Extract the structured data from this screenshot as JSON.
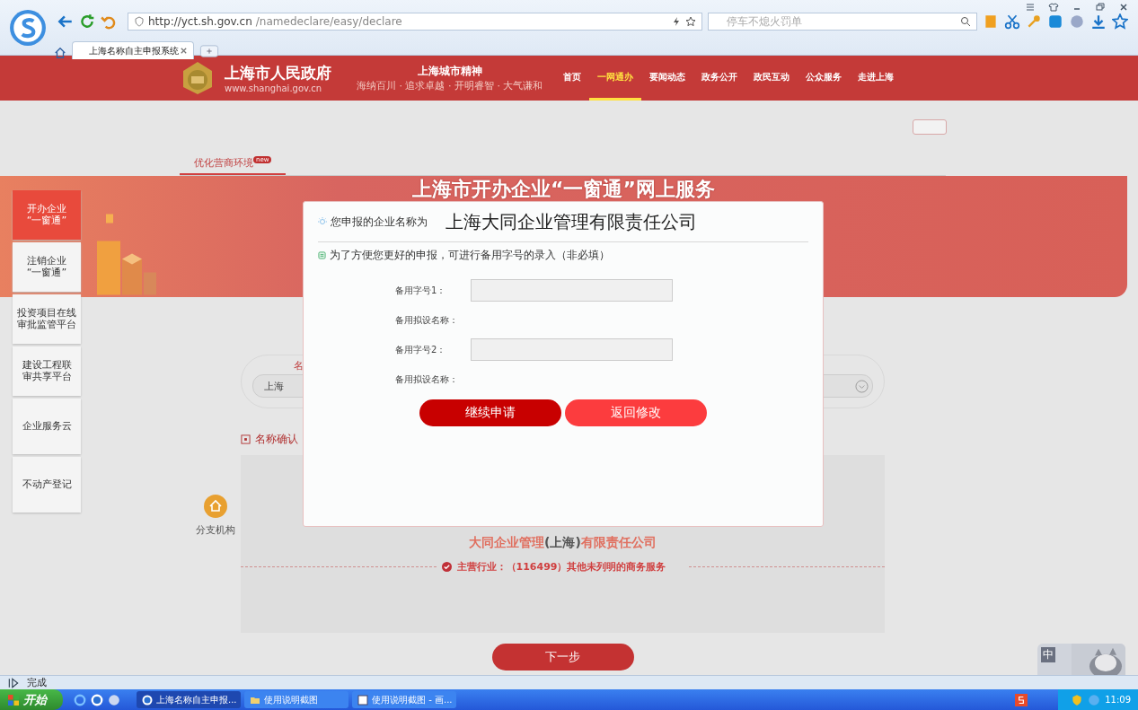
{
  "browser": {
    "address_host": "http://yct.sh.gov.cn",
    "address_path": "/namedeclare/easy/declare",
    "search_placeholder": "停车不熄火罚单",
    "tab_title": "上海名称自主申报系统"
  },
  "header": {
    "site_name": "上海市人民政府",
    "site_url": "www.shanghai.gov.cn",
    "slogan_title": "上海城市精神",
    "slogan": "海纳百川 · 追求卓越 · 开明睿智 · 大气谦和",
    "nav": [
      {
        "label": "首页",
        "selected": false
      },
      {
        "label": "一网通办",
        "selected": true
      },
      {
        "label": "要闻动态",
        "selected": false
      },
      {
        "label": "政务公开",
        "selected": false
      },
      {
        "label": "政民互动",
        "selected": false
      },
      {
        "label": "公众服务",
        "selected": false
      },
      {
        "label": "走进上海",
        "selected": false
      }
    ]
  },
  "subnav": {
    "label": "优化营商环境",
    "badge": "new"
  },
  "banner_title": "上海市开办企业“一窗通”网上服务",
  "sidebar": [
    {
      "lines": [
        "开办企业",
        "“一窗通”"
      ],
      "selected": true
    },
    {
      "lines": [
        "注销企业",
        "“一窗通”"
      ],
      "selected": false
    },
    {
      "lines": [
        "投资项目在线",
        "审批监管平台"
      ],
      "selected": false
    },
    {
      "lines": [
        "建设工程联",
        "审共享平台"
      ],
      "selected": false
    },
    {
      "lines": [
        "企业服务云"
      ],
      "selected": false
    },
    {
      "lines": [
        "不动产登记"
      ],
      "selected": false
    }
  ],
  "search": {
    "label": "名",
    "value": "上海"
  },
  "section_title": "名称确认",
  "branch_label": "分支机构",
  "result": {
    "name_prefix": "大同企业管理",
    "name_region": "(上海)",
    "name_suffix": "有限责任公司",
    "industry": "主营行业：（116499）其他未列明的商务服务"
  },
  "next_button": "下一步",
  "modal": {
    "intro": "您申报的企业名称为",
    "company_name": "上海大同企业管理有限责任公司",
    "note": "为了方便您更好的申报，可进行备用字号的录入（非必填）",
    "rows": [
      {
        "kind": "input",
        "label": "备用字号1："
      },
      {
        "kind": "text",
        "label": "备用拟设名称："
      },
      {
        "kind": "input",
        "label": "备用字号2："
      },
      {
        "kind": "text",
        "label": "备用拟设名称："
      }
    ],
    "buttons": [
      {
        "label": "继续申请",
        "kind": "primary"
      },
      {
        "label": "返回修改",
        "kind": "secondary"
      }
    ]
  },
  "status": "完成",
  "ime": "中",
  "taskbar": {
    "start": "开始",
    "tasks": [
      {
        "label": "上海名称自主申报...",
        "selected": true,
        "kind": "browser"
      },
      {
        "label": "使用说明截图",
        "selected": false,
        "kind": "folder"
      },
      {
        "label": "使用说明截图 - 画...",
        "selected": false,
        "kind": "paint"
      }
    ],
    "time": "11:09"
  }
}
